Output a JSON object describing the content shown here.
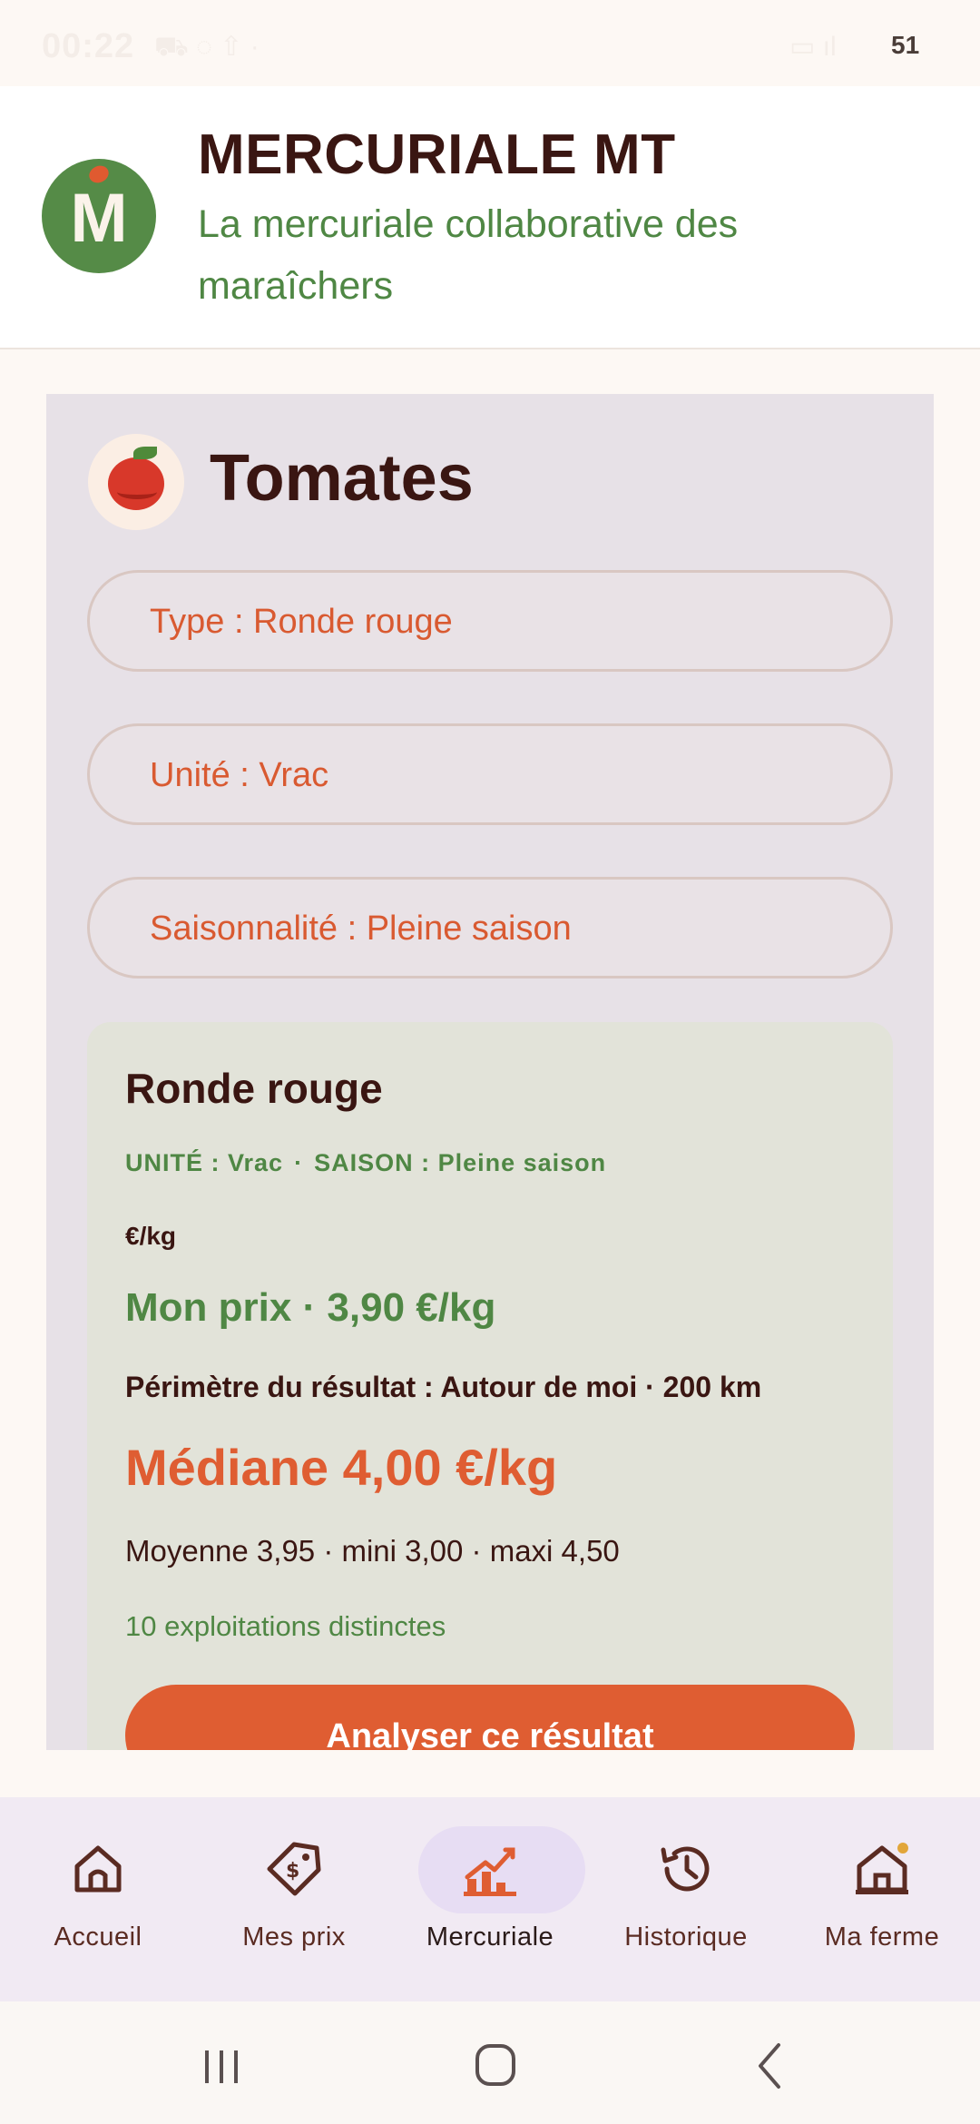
{
  "status_bar": {
    "time": "00:22",
    "battery": "51"
  },
  "header": {
    "logo_letter": "M",
    "title": "MERCURIALE MT",
    "subtitle": "La mercuriale collaborative des maraîchers"
  },
  "product": {
    "icon": "tomato-icon",
    "title": "Tomates",
    "filters": [
      {
        "label": "Type : Ronde rouge"
      },
      {
        "label": "Unité : Vrac"
      },
      {
        "label": "Saisonnalité : Pleine saison"
      }
    ]
  },
  "result": {
    "title": "Ronde rouge",
    "unit_meta": "UNITÉ : Vrac",
    "meta_separator": "·",
    "season_meta": "SAISON : Pleine saison",
    "unit_label": "€/kg",
    "my_price": "Mon prix · 3,90 €/kg",
    "perimeter": "Périmètre du résultat : Autour de moi · 200 km",
    "median": "Médiane 4,00 €/kg",
    "stats": "Moyenne 3,95 · mini 3,00 · maxi 4,50",
    "farms": "10 exploitations distinctes",
    "analyze_button": "Analyser ce résultat"
  },
  "bottom_nav": {
    "items": [
      {
        "label": "Accueil",
        "icon": "home-icon",
        "active": false
      },
      {
        "label": "Mes prix",
        "icon": "price-tag-icon",
        "active": false
      },
      {
        "label": "Mercuriale",
        "icon": "chart-icon",
        "active": true
      },
      {
        "label": "Historique",
        "icon": "history-icon",
        "active": false
      },
      {
        "label": "Ma ferme",
        "icon": "farm-icon",
        "active": false
      }
    ]
  },
  "colors": {
    "accent_orange": "#df5d32",
    "brand_green": "#4f8744",
    "dark_text": "#3a1612"
  }
}
